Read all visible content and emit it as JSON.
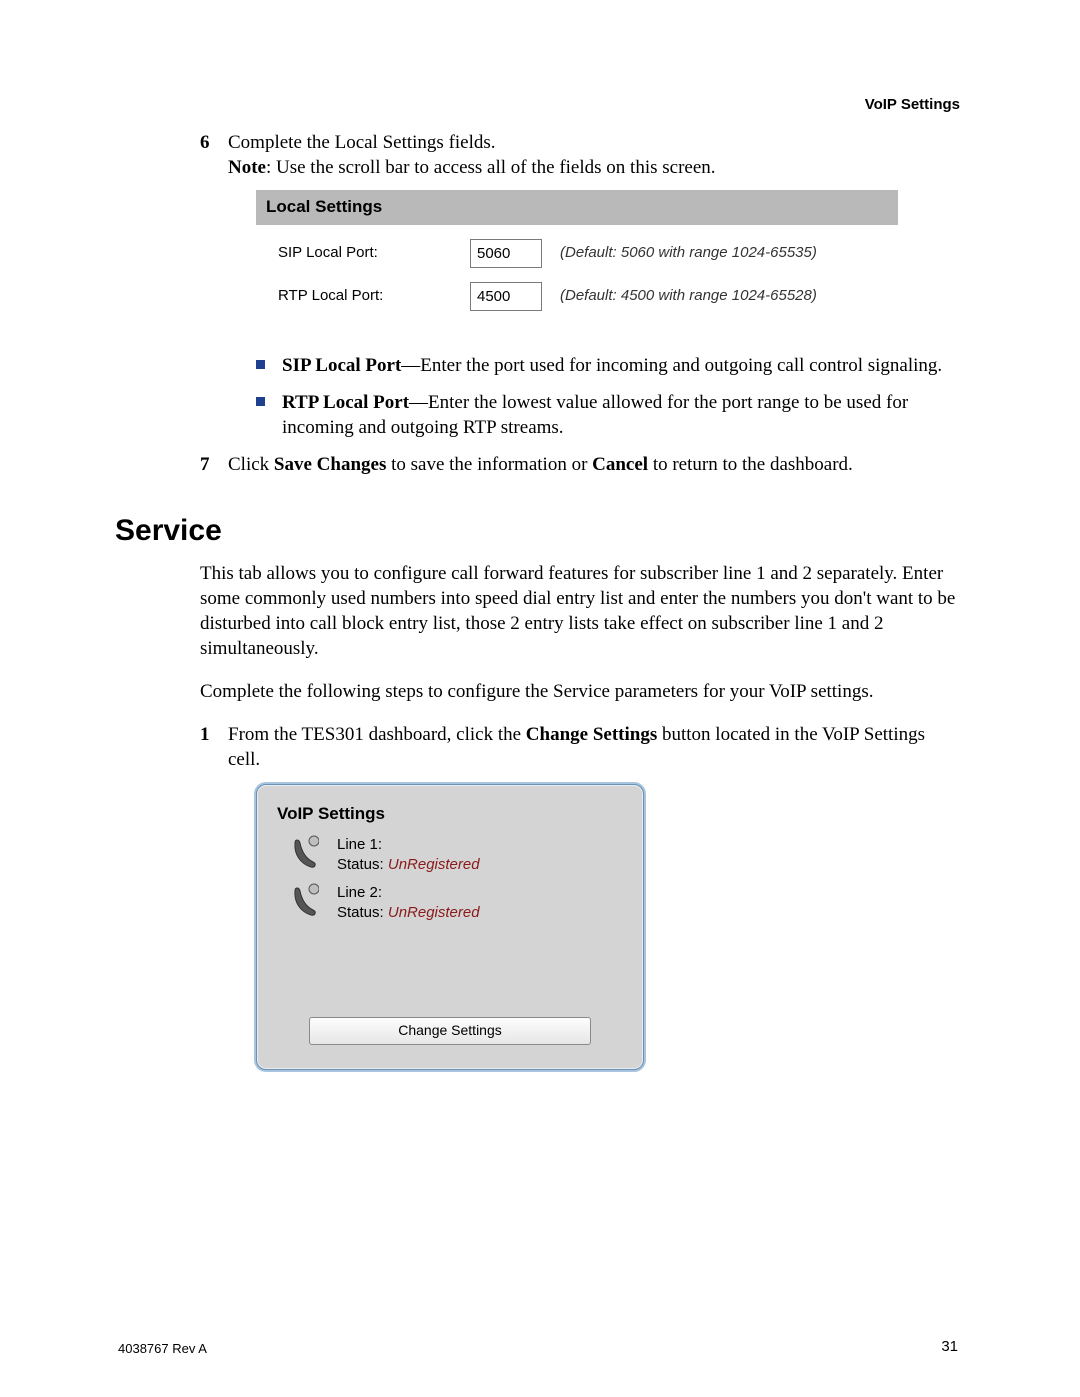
{
  "header": {
    "section": "VoIP Settings"
  },
  "steps_a": {
    "s6": {
      "num": "6",
      "line1": "Complete the Local Settings fields.",
      "note_label": "Note",
      "note_rest": ": Use the scroll bar to access all of the fields on this screen."
    },
    "local_settings": {
      "title": "Local Settings",
      "rows": [
        {
          "label": "SIP Local Port:",
          "value": "5060",
          "hint": "(Default: 5060 with range 1024-65535)"
        },
        {
          "label": "RTP Local Port:",
          "value": "4500",
          "hint": "(Default: 4500 with range 1024-65528)"
        }
      ]
    },
    "bullets": {
      "b1_bold": "SIP Local Port",
      "b1_rest": "—Enter the port used for incoming and outgoing call control signaling.",
      "b2_bold": "RTP Local Port",
      "b2_rest": "—Enter the lowest value allowed for the port range to be used for incoming and outgoing RTP streams."
    },
    "s7": {
      "num": "7",
      "pre": "Click ",
      "save": "Save Changes",
      "mid": " to save the information or ",
      "cancel": "Cancel",
      "post": " to return to the dashboard."
    }
  },
  "service": {
    "heading": "Service",
    "p1": "This tab allows you to configure call forward features for subscriber line 1 and 2 separately. Enter some commonly used numbers into speed dial entry list and enter the numbers you don't want to be disturbed into call block entry list, those 2 entry lists take effect on subscriber line 1 and 2 simultaneously.",
    "p2": "Complete the following steps to configure the Service parameters for your VoIP settings.",
    "s1": {
      "num": "1",
      "pre": "From the TES301 dashboard, click the ",
      "btn": "Change Settings",
      "post": " button located in the VoIP Settings cell."
    },
    "card": {
      "title": "VoIP Settings",
      "lines": [
        {
          "label": "Line 1:",
          "status_label": "Status: ",
          "status_value": "UnRegistered"
        },
        {
          "label": "Line 2:",
          "status_label": "Status: ",
          "status_value": "UnRegistered"
        }
      ],
      "button": "Change Settings"
    }
  },
  "footer": {
    "left": "4038767 Rev A",
    "right": "31"
  }
}
